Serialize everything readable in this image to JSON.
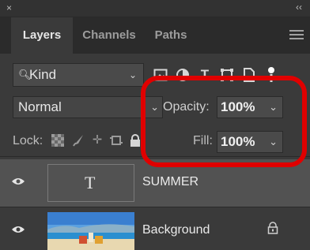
{
  "window": {
    "close_glyph": "×",
    "collapse_glyph": "‹‹"
  },
  "tabs": [
    {
      "label": "Layers",
      "active": true
    },
    {
      "label": "Channels",
      "active": false
    },
    {
      "label": "Paths",
      "active": false
    }
  ],
  "filter": {
    "kind_label": "Kind",
    "icons": [
      "image-filter-icon",
      "adjustment-filter-icon",
      "type-filter-icon",
      "shape-filter-icon",
      "smart-object-filter-icon",
      "filter-toggle-icon"
    ]
  },
  "blend": {
    "mode": "Normal",
    "opacity_label": "Opacity:",
    "opacity_value": "100%",
    "fill_label": "Fill:",
    "fill_value": "100%"
  },
  "lock": {
    "label": "Lock:",
    "icons": [
      "lock-transparent-pixels-icon",
      "lock-image-pixels-icon",
      "lock-position-icon",
      "lock-artboard-icon",
      "lock-all-icon"
    ]
  },
  "layers": [
    {
      "name": "SUMMER",
      "type": "text",
      "selected": true,
      "visible": true
    },
    {
      "name": "Background",
      "type": "image",
      "selected": false,
      "visible": true,
      "locked": true
    }
  ],
  "colors": {
    "highlight": "#e00000",
    "panel_bg": "#3a3a3a",
    "selected_layer_bg": "#525252"
  }
}
